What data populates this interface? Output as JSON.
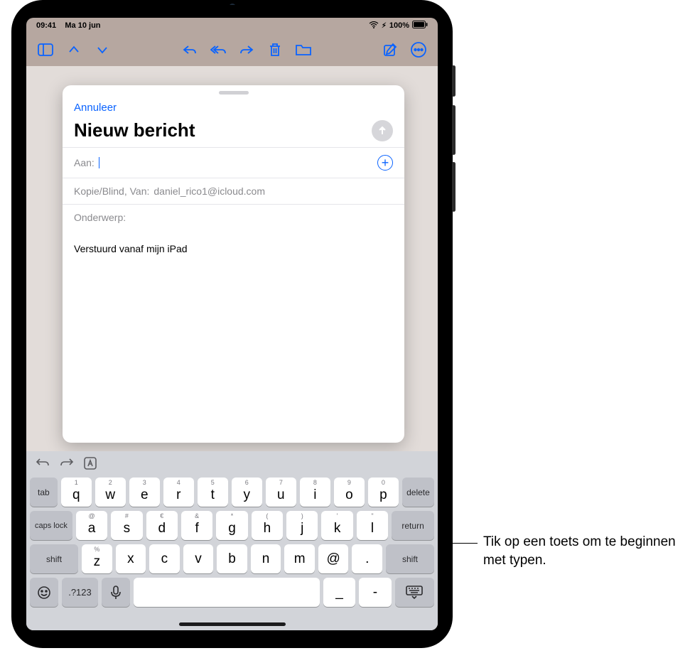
{
  "status": {
    "time": "09:41",
    "date": "Ma 10 jun",
    "battery": "100%"
  },
  "compose": {
    "cancel": "Annuleer",
    "title": "Nieuw bericht",
    "to_label": "Aan:",
    "cc_label": "Kopie/Blind, Van:",
    "cc_value": "daniel_rico1@icloud.com",
    "subject_label": "Onderwerp:",
    "body_signature": "Verstuurd vanaf mijn iPad"
  },
  "keyboard": {
    "row1": [
      {
        "hint": "1",
        "main": "q"
      },
      {
        "hint": "2",
        "main": "w"
      },
      {
        "hint": "3",
        "main": "e"
      },
      {
        "hint": "4",
        "main": "r"
      },
      {
        "hint": "5",
        "main": "t"
      },
      {
        "hint": "6",
        "main": "y"
      },
      {
        "hint": "7",
        "main": "u"
      },
      {
        "hint": "8",
        "main": "i"
      },
      {
        "hint": "9",
        "main": "o"
      },
      {
        "hint": "0",
        "main": "p"
      }
    ],
    "row2": [
      {
        "hint": "@",
        "main": "a"
      },
      {
        "hint": "#",
        "main": "s"
      },
      {
        "hint": "€",
        "main": "d"
      },
      {
        "hint": "&",
        "main": "f"
      },
      {
        "hint": "*",
        "main": "g"
      },
      {
        "hint": "(",
        "main": "h"
      },
      {
        "hint": ")",
        "main": "j"
      },
      {
        "hint": "'",
        "main": "k"
      },
      {
        "hint": "\"",
        "main": "l"
      }
    ],
    "row3": [
      {
        "hint": "%",
        "main": "z"
      },
      {
        "hint": "",
        "main": "x"
      },
      {
        "hint": "",
        "main": "c"
      },
      {
        "hint": "",
        "main": "v"
      },
      {
        "hint": "",
        "main": "b"
      },
      {
        "hint": "",
        "main": "n"
      },
      {
        "hint": "",
        "main": "m"
      },
      {
        "hint": "",
        "main": "@"
      },
      {
        "hint": "",
        "main": "."
      }
    ],
    "tab": "tab",
    "delete": "delete",
    "caps": "caps lock",
    "return": "return",
    "shift": "shift",
    "numswitch": ".?123",
    "underscore": "_",
    "hyphen": "-"
  },
  "callout": "Tik op een toets om te beginnen met typen."
}
